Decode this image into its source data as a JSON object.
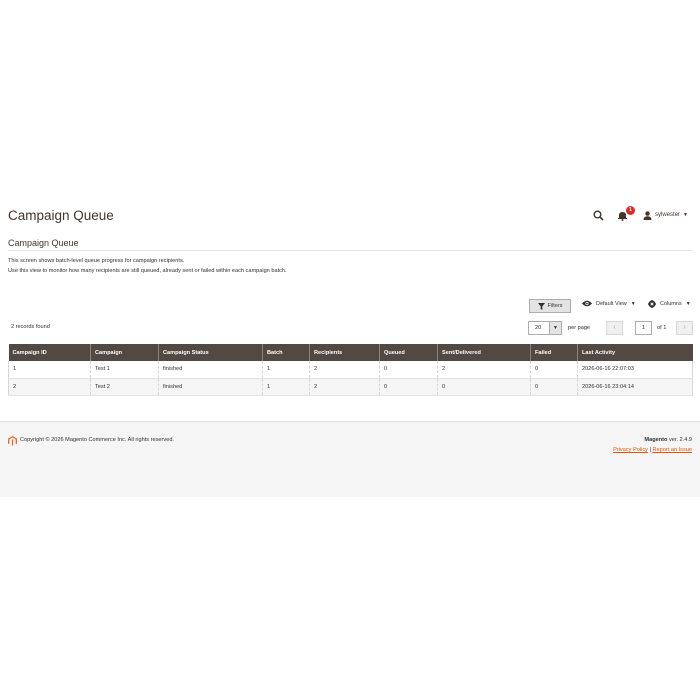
{
  "header": {
    "title": "Campaign Queue",
    "notification_count": "1",
    "username": "sylwester"
  },
  "section": {
    "title": "Campaign Queue",
    "description_1": "This screen shows batch-level queue progress for campaign recipients.",
    "description_2": "Use this view to monitor how many recipients are still queued, already sent or failed within each campaign batch."
  },
  "toolbar": {
    "filters_label": "Filters",
    "view_label": "Default View",
    "columns_label": "Columns"
  },
  "grid": {
    "records_found": "2 records found",
    "per_page_value": "20",
    "per_page_label": "per page",
    "current_page": "1",
    "of_pages": "of 1",
    "columns": [
      "Campaign ID",
      "Campaign",
      "Campaign Status",
      "Batch",
      "Recipients",
      "Queued",
      "Sent/Delivered",
      "Failed",
      "Last Activity"
    ],
    "rows": [
      [
        "1",
        "Test 1",
        "finished",
        "1",
        "2",
        "0",
        "2",
        "0",
        "2026-06-16 22:07:03"
      ],
      [
        "2",
        "Test 2",
        "finished",
        "1",
        "2",
        "0",
        "0",
        "0",
        "2026-06-16 23:04:14"
      ]
    ]
  },
  "footer": {
    "copyright": "Copyright © 2026 Magento Commerce Inc. All rights reserved.",
    "product_name": "Magento",
    "version": " ver. 2.4.9",
    "privacy_label": "Privacy Policy",
    "separator": "|",
    "report_label": "Report an Issue"
  },
  "colors": {
    "grid_header_bg": "#514943",
    "link": "#eb5202",
    "notification_badge": "#e22626",
    "logo": "#f26322"
  },
  "icons": {
    "search": "search-icon",
    "notifications": "bell-icon",
    "user": "user-icon",
    "filter": "funnel-icon",
    "view": "eye-icon",
    "columns": "gear-icon",
    "logo": "magento-logo"
  }
}
